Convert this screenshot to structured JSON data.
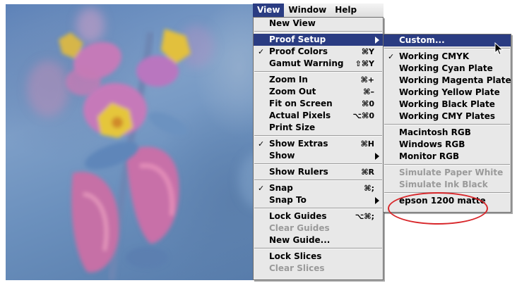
{
  "menubar": {
    "titles": [
      "View",
      "Window",
      "Help"
    ],
    "active": "View"
  },
  "view_menu": {
    "items": [
      {
        "label": "New View",
        "shortcut": "",
        "checked": false,
        "submenu": false,
        "disabled": false
      },
      {
        "label": "Proof Setup",
        "shortcut": "",
        "checked": false,
        "submenu": true,
        "disabled": false,
        "highlighted": true
      },
      {
        "label": "Proof Colors",
        "shortcut": "⌘Y",
        "checked": true,
        "submenu": false,
        "disabled": false
      },
      {
        "label": "Gamut Warning",
        "shortcut": "⇧⌘Y",
        "checked": false,
        "submenu": false,
        "disabled": false
      },
      {
        "label": "Zoom In",
        "shortcut": "⌘+",
        "checked": false,
        "submenu": false,
        "disabled": false
      },
      {
        "label": "Zoom Out",
        "shortcut": "⌘–",
        "checked": false,
        "submenu": false,
        "disabled": false
      },
      {
        "label": "Fit on Screen",
        "shortcut": "⌘0",
        "checked": false,
        "submenu": false,
        "disabled": false
      },
      {
        "label": "Actual Pixels",
        "shortcut": "⌥⌘0",
        "checked": false,
        "submenu": false,
        "disabled": false
      },
      {
        "label": "Print Size",
        "shortcut": "",
        "checked": false,
        "submenu": false,
        "disabled": false
      },
      {
        "label": "Show Extras",
        "shortcut": "⌘H",
        "checked": true,
        "submenu": false,
        "disabled": false
      },
      {
        "label": "Show",
        "shortcut": "",
        "checked": false,
        "submenu": true,
        "disabled": false
      },
      {
        "label": "Show Rulers",
        "shortcut": "⌘R",
        "checked": false,
        "submenu": false,
        "disabled": false
      },
      {
        "label": "Snap",
        "shortcut": "⌘;",
        "checked": true,
        "submenu": false,
        "disabled": false
      },
      {
        "label": "Snap To",
        "shortcut": "",
        "checked": false,
        "submenu": true,
        "disabled": false
      },
      {
        "label": "Lock Guides",
        "shortcut": "⌥⌘;",
        "checked": false,
        "submenu": false,
        "disabled": false
      },
      {
        "label": "Clear Guides",
        "shortcut": "",
        "checked": false,
        "submenu": false,
        "disabled": true
      },
      {
        "label": "New Guide...",
        "shortcut": "",
        "checked": false,
        "submenu": false,
        "disabled": false
      },
      {
        "label": "Lock Slices",
        "shortcut": "",
        "checked": false,
        "submenu": false,
        "disabled": false
      },
      {
        "label": "Clear Slices",
        "shortcut": "",
        "checked": false,
        "submenu": false,
        "disabled": true
      }
    ]
  },
  "proof_setup_menu": {
    "items": [
      {
        "label": "Custom...",
        "checked": false,
        "disabled": false,
        "highlighted": true
      },
      {
        "label": "Working CMYK",
        "checked": true,
        "disabled": false
      },
      {
        "label": "Working Cyan Plate",
        "checked": false,
        "disabled": false
      },
      {
        "label": "Working Magenta Plate",
        "checked": false,
        "disabled": false
      },
      {
        "label": "Working Yellow Plate",
        "checked": false,
        "disabled": false
      },
      {
        "label": "Working Black Plate",
        "checked": false,
        "disabled": false
      },
      {
        "label": "Working CMY Plates",
        "checked": false,
        "disabled": false
      },
      {
        "label": "Macintosh RGB",
        "checked": false,
        "disabled": false
      },
      {
        "label": "Windows RGB",
        "checked": false,
        "disabled": false
      },
      {
        "label": "Monitor RGB",
        "checked": false,
        "disabled": false
      },
      {
        "label": "Simulate Paper White",
        "checked": false,
        "disabled": true
      },
      {
        "label": "Simulate Ink Black",
        "checked": false,
        "disabled": true
      },
      {
        "label": "epson 1200 matte",
        "checked": false,
        "disabled": false,
        "circled": true
      }
    ]
  },
  "colors": {
    "highlight": "#2a3c82",
    "menu_bg": "#e8e8e8",
    "disabled_text": "#9a9a9a",
    "annotation": "#d8262a"
  },
  "icons": {
    "checkmark": "✓",
    "submenu_arrow": "triangle-right",
    "pointer": "arrow-pointer"
  }
}
